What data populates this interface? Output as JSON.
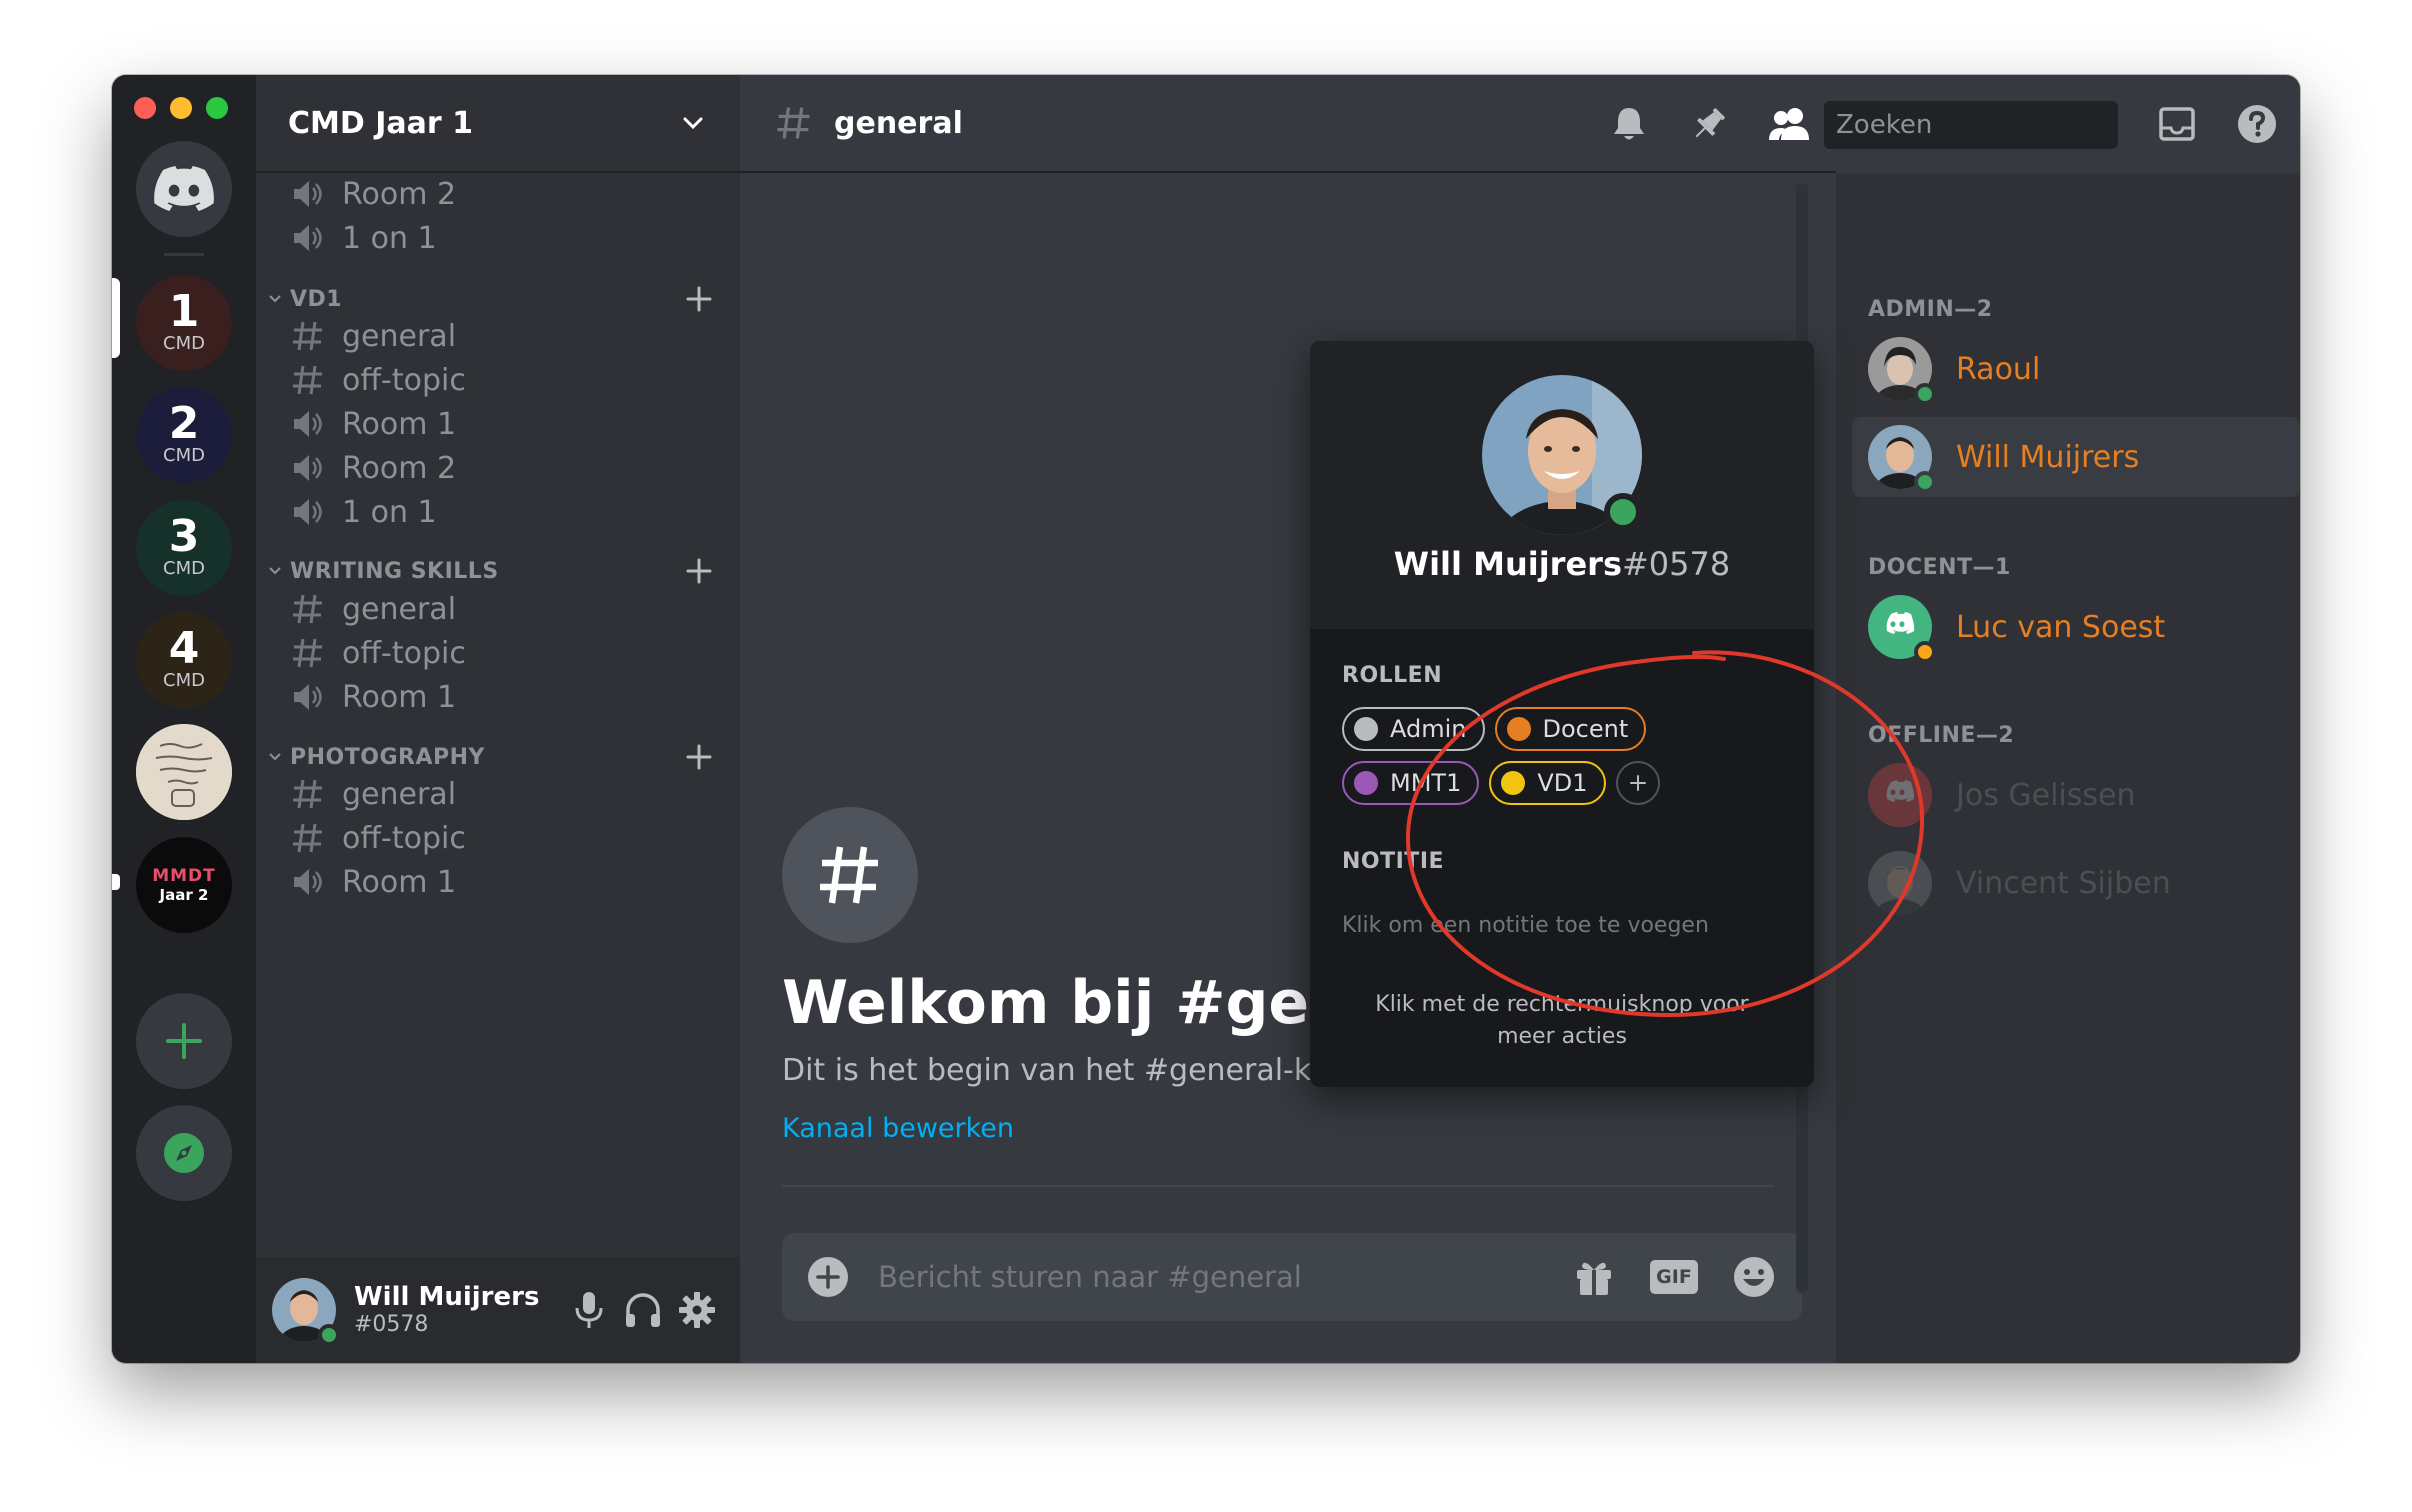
{
  "window": {
    "controls": [
      "close",
      "minimize",
      "maximize"
    ]
  },
  "servers": {
    "items": [
      {
        "icon": "discord-logo-icon",
        "kind": "home"
      },
      {
        "number": "1",
        "label": "CMD",
        "bg": "#3a1f1f",
        "selected": true
      },
      {
        "number": "2",
        "label": "CMD",
        "bg": "#1b1d3b"
      },
      {
        "number": "3",
        "label": "CMD",
        "bg": "#16302a"
      },
      {
        "number": "4",
        "label": "CMD",
        "bg": "#2c2416"
      },
      {
        "icon": "handwritten-note-image",
        "bg": "#d8cdbd"
      },
      {
        "label_top": "MMDT",
        "label_bottom": "Jaar 2",
        "bg": "#0b0b0b",
        "unread": true
      },
      {
        "icon": "plus-icon",
        "kind": "add-server",
        "color": "#3ba55d"
      },
      {
        "icon": "compass-icon",
        "kind": "explore",
        "color": "#3ba55d"
      }
    ]
  },
  "guild": {
    "name": "CMD Jaar 1"
  },
  "channels": {
    "top": [
      {
        "type": "voice",
        "name": "Room 2"
      },
      {
        "type": "voice",
        "name": "1 on 1"
      }
    ],
    "categories": [
      {
        "name": "VD1",
        "channels": [
          {
            "type": "text",
            "name": "general"
          },
          {
            "type": "text",
            "name": "off-topic"
          },
          {
            "type": "voice",
            "name": "Room 1"
          },
          {
            "type": "voice",
            "name": "Room 2"
          },
          {
            "type": "voice",
            "name": "1 on 1"
          }
        ]
      },
      {
        "name": "WRITING SKILLS",
        "channels": [
          {
            "type": "text",
            "name": "general"
          },
          {
            "type": "text",
            "name": "off-topic"
          },
          {
            "type": "voice",
            "name": "Room 1"
          }
        ]
      },
      {
        "name": "PHOTOGRAPHY",
        "channels": [
          {
            "type": "text",
            "name": "general"
          },
          {
            "type": "text",
            "name": "off-topic"
          },
          {
            "type": "voice",
            "name": "Room 1"
          }
        ]
      }
    ]
  },
  "user_panel": {
    "name": "Will Muijrers",
    "tag": "#0578",
    "status": "online"
  },
  "chat": {
    "channel": "general",
    "welcome_title": "Welkom bij #general",
    "welcome_subtitle": "Dit is het begin van het #general-kanaal.",
    "edit_link": "Kanaal bewerken",
    "composer_placeholder": "Bericht sturen naar #general",
    "gif_label": "GIF"
  },
  "header_tools": {
    "search_placeholder": "Zoeken",
    "icons": [
      "bell-icon",
      "pin-icon",
      "members-icon",
      "search-icon",
      "inbox-icon",
      "help-icon"
    ]
  },
  "members": {
    "groups": [
      {
        "title": "ADMIN—2",
        "members": [
          {
            "name": "Raoul",
            "status": "online"
          },
          {
            "name": "Will Muijrers",
            "status": "online",
            "active": true
          }
        ]
      },
      {
        "title": "DOCENT—1",
        "members": [
          {
            "name": "Luc van Soest",
            "status": "idle"
          }
        ]
      },
      {
        "title": "OFFLINE—2",
        "members": [
          {
            "name": "Jos Gelissen",
            "status": "offline"
          },
          {
            "name": "Vincent Sijben",
            "status": "offline"
          }
        ]
      }
    ],
    "name_color": "#e67e22"
  },
  "popout": {
    "username": "Will Muijrers",
    "discriminator": "#0578",
    "roles_title": "ROLLEN",
    "roles": [
      {
        "name": "Admin",
        "color": "#b9bbbe"
      },
      {
        "name": "Docent",
        "color": "#e67e22"
      },
      {
        "name": "MMT1",
        "color": "#9b59b6"
      },
      {
        "name": "VD1",
        "color": "#f1c40f"
      }
    ],
    "note_title": "NOTITIE",
    "note_placeholder": "Klik om een notitie toe te voegen",
    "footer": "Klik met de rechtermuisknop voor meer acties"
  },
  "colors": {
    "annotation": "#e0392b",
    "online": "#3ba55d",
    "idle": "#faa61a",
    "link": "#00b0f4"
  }
}
